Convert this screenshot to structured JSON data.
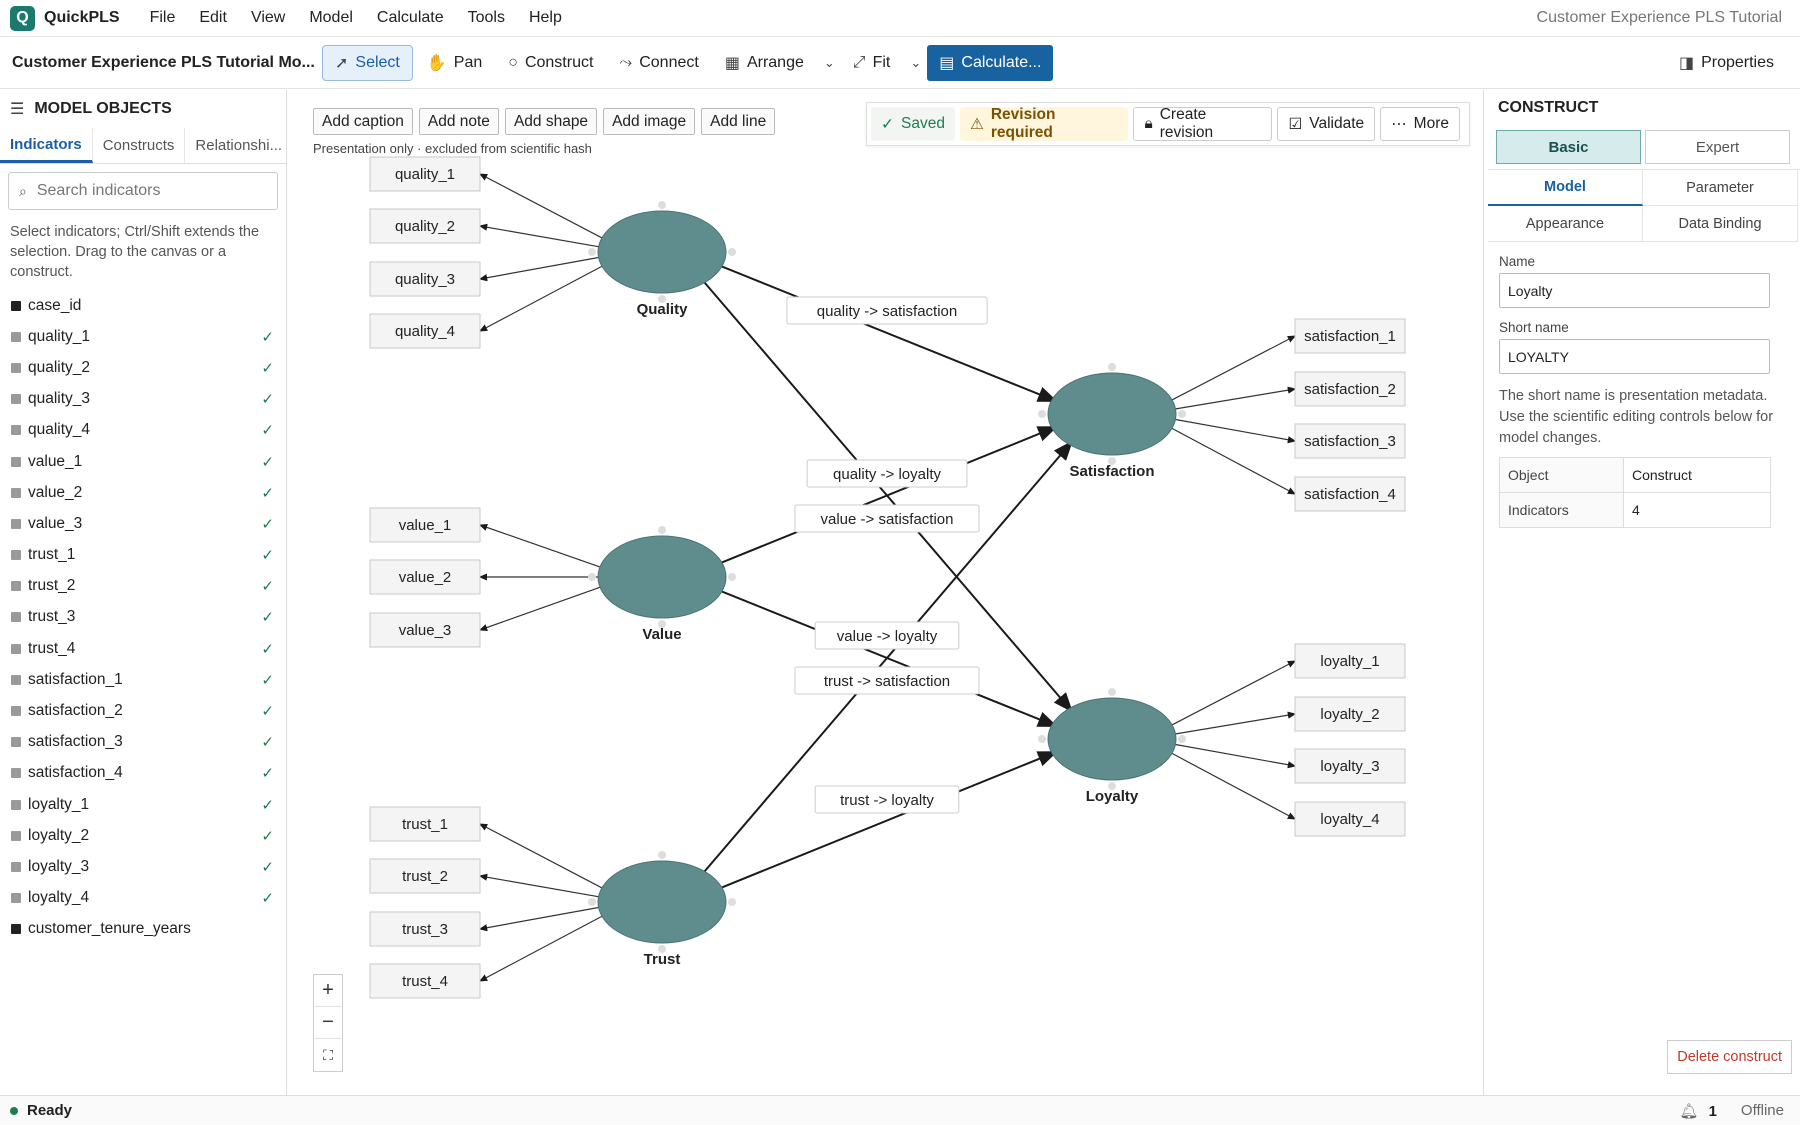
{
  "app": {
    "name": "QuickPLS",
    "logo_letter": "Q",
    "window_title": "Customer Experience PLS Tutorial"
  },
  "menu": [
    "File",
    "Edit",
    "View",
    "Model",
    "Calculate",
    "Tools",
    "Help"
  ],
  "toolbar": {
    "model_name": "Customer Experience PLS Tutorial Mo...",
    "select": "Select",
    "pan": "Pan",
    "construct": "Construct",
    "connect": "Connect",
    "arrange": "Arrange",
    "fit": "Fit",
    "calculate": "Calculate...",
    "properties": "Properties"
  },
  "sidebar": {
    "title": "MODEL OBJECTS",
    "tabs": [
      "Indicators",
      "Constructs",
      "Relationshi..."
    ],
    "search_placeholder": "Search indicators",
    "hint": "Select indicators; Ctrl/Shift extends the selection. Drag to the canvas or a construct.",
    "indicators": [
      {
        "name": "case_id",
        "used": false
      },
      {
        "name": "quality_1",
        "used": true
      },
      {
        "name": "quality_2",
        "used": true
      },
      {
        "name": "quality_3",
        "used": true
      },
      {
        "name": "quality_4",
        "used": true
      },
      {
        "name": "value_1",
        "used": true
      },
      {
        "name": "value_2",
        "used": true
      },
      {
        "name": "value_3",
        "used": true
      },
      {
        "name": "trust_1",
        "used": true
      },
      {
        "name": "trust_2",
        "used": true
      },
      {
        "name": "trust_3",
        "used": true
      },
      {
        "name": "trust_4",
        "used": true
      },
      {
        "name": "satisfaction_1",
        "used": true
      },
      {
        "name": "satisfaction_2",
        "used": true
      },
      {
        "name": "satisfaction_3",
        "used": true
      },
      {
        "name": "satisfaction_4",
        "used": true
      },
      {
        "name": "loyalty_1",
        "used": true
      },
      {
        "name": "loyalty_2",
        "used": true
      },
      {
        "name": "loyalty_3",
        "used": true
      },
      {
        "name": "loyalty_4",
        "used": true
      },
      {
        "name": "customer_tenure_years",
        "used": false
      }
    ]
  },
  "canvas": {
    "add_buttons": [
      "Add caption",
      "Add note",
      "Add shape",
      "Add image",
      "Add line"
    ],
    "presentation_note": "Presentation only · excluded from scientific hash",
    "status": {
      "saved": "Saved",
      "revision": "Revision required",
      "create_revision": "Create revision",
      "validate": "Validate",
      "more": "More"
    }
  },
  "diagram": {
    "constructs": [
      {
        "id": "quality",
        "label": "Quality",
        "indicators": [
          "quality_1",
          "quality_2",
          "quality_3",
          "quality_4"
        ],
        "side": "left"
      },
      {
        "id": "value",
        "label": "Value",
        "indicators": [
          "value_1",
          "value_2",
          "value_3"
        ],
        "side": "left"
      },
      {
        "id": "trust",
        "label": "Trust",
        "indicators": [
          "trust_1",
          "trust_2",
          "trust_3",
          "trust_4"
        ],
        "side": "left"
      },
      {
        "id": "satisfaction",
        "label": "Satisfaction",
        "indicators": [
          "satisfaction_1",
          "satisfaction_2",
          "satisfaction_3",
          "satisfaction_4"
        ],
        "side": "right"
      },
      {
        "id": "loyalty",
        "label": "Loyalty",
        "indicators": [
          "loyalty_1",
          "loyalty_2",
          "loyalty_3",
          "loyalty_4"
        ],
        "side": "right"
      }
    ],
    "paths": [
      {
        "from": "quality",
        "to": "satisfaction",
        "label": "quality -> satisfaction"
      },
      {
        "from": "quality",
        "to": "loyalty",
        "label": "quality -> loyalty"
      },
      {
        "from": "value",
        "to": "satisfaction",
        "label": "value -> satisfaction"
      },
      {
        "from": "value",
        "to": "loyalty",
        "label": "value -> loyalty"
      },
      {
        "from": "trust",
        "to": "satisfaction",
        "label": "trust -> satisfaction"
      },
      {
        "from": "trust",
        "to": "loyalty",
        "label": "trust -> loyalty"
      }
    ],
    "construct_color": "#5f8d8d"
  },
  "zoom": {
    "in": "+",
    "out": "−",
    "fit": "⛶"
  },
  "panel": {
    "title": "CONSTRUCT",
    "modes": [
      "Basic",
      "Expert"
    ],
    "tabs": [
      "Model",
      "Parameter",
      "Appearance",
      "Data Binding"
    ],
    "name_label": "Name",
    "name_value": "Loyalty",
    "short_label": "Short name",
    "short_value": "LOYALTY",
    "help": "The short name is presentation metadata. Use the scientific editing controls below for model changes.",
    "table": [
      [
        "Object",
        "Construct"
      ],
      [
        "Indicators",
        "4"
      ]
    ],
    "delete": "Delete construct"
  },
  "footer": {
    "status": "Ready",
    "notifications": "1",
    "connection": "Offline"
  }
}
